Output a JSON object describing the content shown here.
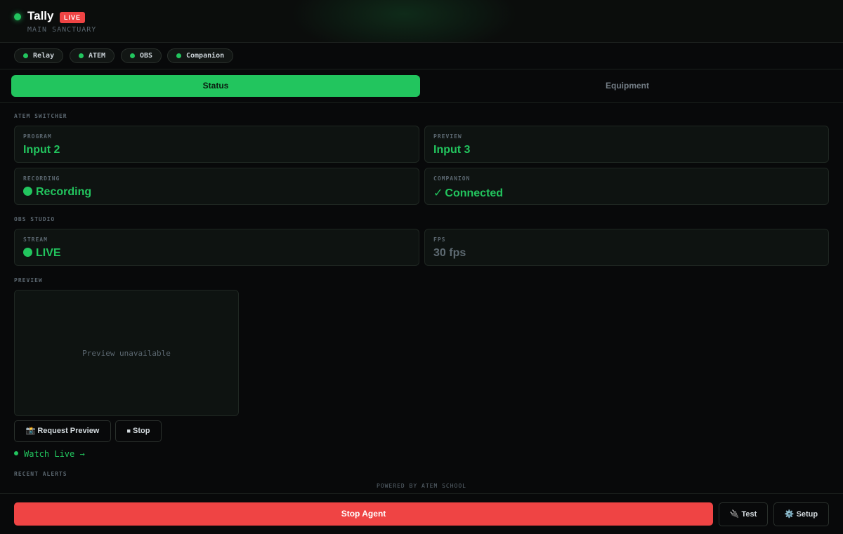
{
  "header": {
    "title": "Tally",
    "live_badge": "LIVE",
    "location": "MAIN SANCTUARY"
  },
  "connections": [
    {
      "label": "Relay",
      "status_color": "#22c55e"
    },
    {
      "label": "ATEM",
      "status_color": "#22c55e"
    },
    {
      "label": "OBS",
      "status_color": "#22c55e"
    },
    {
      "label": "Companion",
      "status_color": "#22c55e"
    }
  ],
  "tabs": [
    {
      "label": "Status",
      "active": true
    },
    {
      "label": "Equipment",
      "active": false
    }
  ],
  "atem": {
    "section_label": "ATEM SWITCHER",
    "program": {
      "label": "PROGRAM",
      "value": "Input 2"
    },
    "preview": {
      "label": "PREVIEW",
      "value": "Input 3"
    },
    "recording": {
      "label": "RECORDING",
      "value": "Recording"
    },
    "companion": {
      "label": "COMPANION",
      "value": "Connected",
      "icon": "check-icon"
    }
  },
  "obs": {
    "section_label": "OBS STUDIO",
    "stream": {
      "label": "STREAM",
      "value": "LIVE"
    },
    "fps": {
      "label": "FPS",
      "value": "30 fps"
    }
  },
  "preview_panel": {
    "section_label": "PREVIEW",
    "placeholder": "Preview unavailable",
    "request_button": {
      "label": "Request Preview",
      "icon": "camera-icon"
    },
    "stop_button": {
      "label": "Stop",
      "icon": "stop-square-icon"
    },
    "watch_live": "Watch Live →"
  },
  "alerts": {
    "section_label": "RECENT ALERTS"
  },
  "powered_by": "POWERED BY ATEM SCHOOL",
  "footer": {
    "stop_agent": "Stop Agent",
    "test": {
      "label": "Test",
      "icon": "plug-icon"
    },
    "setup": {
      "label": "Setup",
      "icon": "gear-icon"
    }
  },
  "colors": {
    "accent": "#22c55e",
    "danger": "#ef4444",
    "background": "#08090a"
  }
}
